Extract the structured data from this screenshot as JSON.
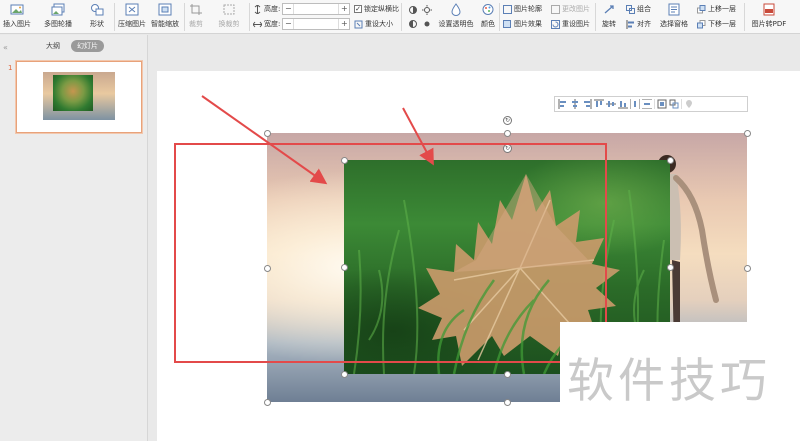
{
  "ribbon": {
    "insert_picture": "插入图片",
    "multi_picture": "多图轮播",
    "shape": "形状",
    "compress_picture": "压缩图片",
    "smart_scale": "智能缩放",
    "crop": "裁剪",
    "replace_crop": "换裁剪",
    "height_label": "高度:",
    "width_label": "宽度:",
    "minus": "−",
    "plus": "+",
    "lock_aspect": "锁定纵横比",
    "lock_aspect_checked": "✓",
    "reset_size": "重设大小",
    "set_transparent": "设置透明色",
    "color": "颜色",
    "picture_outline": "图片轮廓",
    "picture_effects": "图片效果",
    "change_picture": "更改图片",
    "reset_picture": "重设图片",
    "rotate": "旋转",
    "group": "组合",
    "align": "对齐",
    "selection_pane": "选择窗格",
    "bring_forward": "上移一层",
    "send_backward": "下移一层",
    "to_pdf": "图片转PDF"
  },
  "left_pane": {
    "collapse_glyph": "«",
    "tab_outline": "大纲",
    "tab_slides": "幻灯片",
    "slide_number": "1"
  },
  "canvas": {
    "rotate_glyph": "↻"
  },
  "watermark": {
    "text": "软件技巧"
  },
  "colors": {
    "annotation_red": "#e34a4a",
    "accent_orange": "#e0643a"
  }
}
